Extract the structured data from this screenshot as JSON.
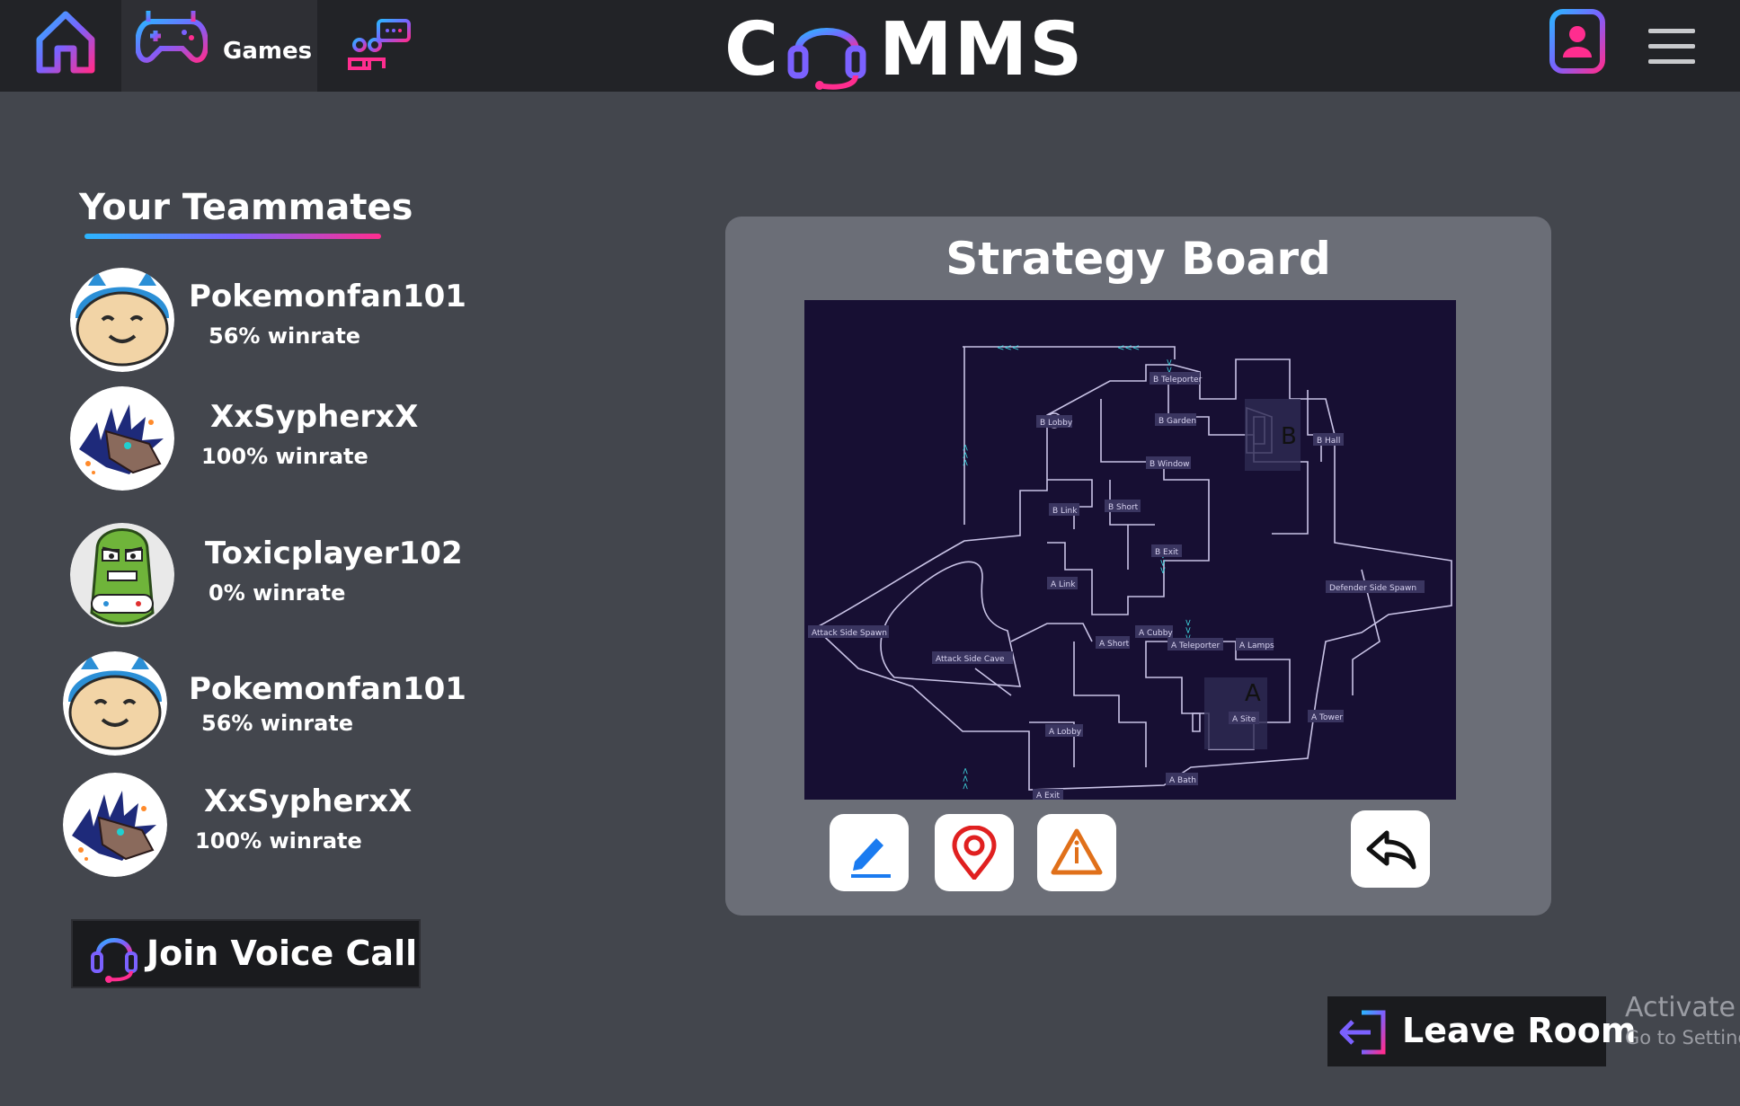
{
  "nav": {
    "home_icon": "home-icon",
    "games_icon": "gamepad-icon",
    "games_label": "Games",
    "chat_icon": "group-chat-icon",
    "logo_left": "C",
    "logo_icon": "headset-icon",
    "logo_right": "MMS",
    "profile_icon": "profile-icon",
    "menu_icon": "hamburger-menu-icon"
  },
  "teammates": {
    "title": "Your Teammates",
    "items": [
      {
        "name": "Pokemonfan101",
        "winrate": "56% winrate",
        "avatar": "snorlax-avatar"
      },
      {
        "name": "XxSypherxX",
        "winrate": "100% winrate",
        "avatar": "dragon-avatar"
      },
      {
        "name": "Toxicplayer102",
        "winrate": "0% winrate",
        "avatar": "pickle-gamer-avatar"
      },
      {
        "name": "Pokemonfan101",
        "winrate": "56% winrate",
        "avatar": "snorlax-avatar"
      },
      {
        "name": "XxSypherxX",
        "winrate": "100% winrate",
        "avatar": "dragon-avatar"
      }
    ]
  },
  "voice": {
    "label": "Join Voice Call",
    "icon": "headset-icon"
  },
  "board": {
    "title": "Strategy Board",
    "map": {
      "site_a": "A",
      "site_b": "B",
      "callouts": [
        "B Teleporter",
        "B Lobby",
        "B Garden",
        "B Window",
        "B Hall",
        "B Link",
        "B Short",
        "B Exit",
        "A Link",
        "Defender Side Spawn",
        "Attack Side Spawn",
        "Attack Side Cave",
        "A Short",
        "A Cubby",
        "A Teleporter",
        "A Lamps",
        "A Site",
        "A Tower",
        "A Lobby",
        "A Bath",
        "A Exit"
      ]
    },
    "tools": [
      {
        "name": "draw-tool",
        "icon": "pencil-icon"
      },
      {
        "name": "marker-tool",
        "icon": "location-pin-icon"
      },
      {
        "name": "warning-tool",
        "icon": "warning-icon"
      },
      {
        "name": "undo-tool",
        "icon": "undo-arrow-icon"
      }
    ]
  },
  "leave": {
    "label": "Leave Room",
    "icon": "exit-icon"
  },
  "watermark": {
    "line1": "Activate W",
    "line2": "Go to Setting"
  },
  "colors": {
    "bg": "#43464d",
    "nav": "#222327",
    "board": "#6b6e77",
    "map": "#170f33",
    "accent_blue": "#2bb6ff",
    "accent_purple": "#7b61ff",
    "accent_pink": "#ff2d8f"
  }
}
